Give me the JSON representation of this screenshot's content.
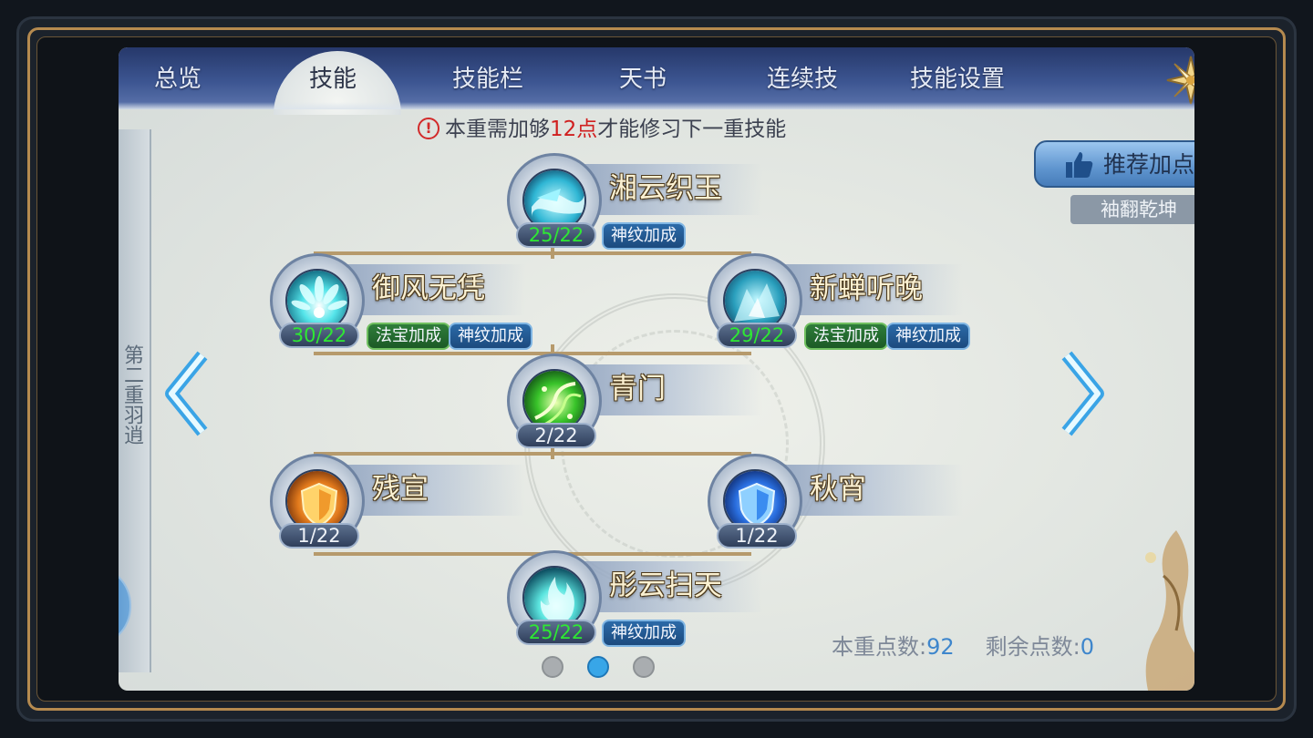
{
  "tabs": [
    {
      "label": "总览",
      "active": false
    },
    {
      "label": "技能",
      "active": true
    },
    {
      "label": "技能栏",
      "active": false
    },
    {
      "label": "天书",
      "active": false
    },
    {
      "label": "连续技",
      "active": false
    },
    {
      "label": "技能设置",
      "active": false
    }
  ],
  "notice": {
    "prefix": "本重需加够",
    "highlight": "12点",
    "suffix": "才能修习下一重技能",
    "icon": "warning-icon",
    "highlight_color": "#d01f1f"
  },
  "side_label": "第二重羽逍",
  "skills": [
    {
      "name": "湘云织玉",
      "level": "25/22",
      "over": true,
      "badges": [
        "神纹加成"
      ],
      "icon": "wave-skill-icon"
    },
    {
      "name": "御风无凭",
      "level": "30/22",
      "over": true,
      "badges": [
        "法宝加成",
        "神纹加成"
      ],
      "icon": "feather-fan-icon"
    },
    {
      "name": "新蝉听晚",
      "level": "29/22",
      "over": true,
      "badges": [
        "法宝加成",
        "神纹加成"
      ],
      "icon": "ice-spirit-icon"
    },
    {
      "name": "青门",
      "level": "2/22",
      "over": false,
      "badges": [],
      "icon": "green-vine-icon"
    },
    {
      "name": "残宣",
      "level": "1/22",
      "over": false,
      "badges": [],
      "icon": "orange-shield-icon"
    },
    {
      "name": "秋宵",
      "level": "1/22",
      "over": false,
      "badges": [],
      "icon": "blue-shield-icon"
    },
    {
      "name": "彤云扫天",
      "level": "25/22",
      "over": true,
      "badges": [
        "神纹加成"
      ],
      "icon": "cyan-flame-icon"
    }
  ],
  "recommend": {
    "label": "推荐加点",
    "sub": "袖翻乾坤",
    "icon": "thumbs-up-icon"
  },
  "points": {
    "tier_label": "本重点数:",
    "tier_value": "92",
    "remain_label": "剩余点数:",
    "remain_value": "0"
  },
  "pagination": {
    "pages": 3,
    "current": 2
  },
  "colors": {
    "accent_blue": "#38a6e8",
    "level_over": "#2ee833",
    "badge_green": "#2e7d3a",
    "badge_blue": "#2b6aa8"
  }
}
